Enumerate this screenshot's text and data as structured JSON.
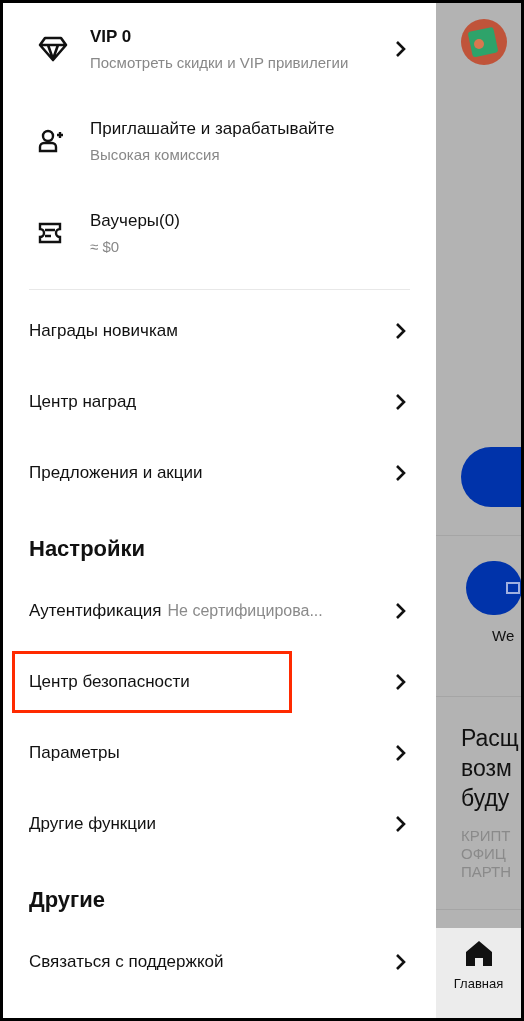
{
  "top_items": [
    {
      "kind": "diamond",
      "title": "VIP 0",
      "subtitle": "Посмотреть скидки и VIP привилегии",
      "chevron": true
    },
    {
      "kind": "person-add",
      "title": "Приглашайте и зарабатывайте",
      "subtitle": "Высокая комиссия",
      "chevron": false
    },
    {
      "kind": "ticket",
      "title": "Ваучеры(0)",
      "subtitle": "≈ $0",
      "chevron": false
    }
  ],
  "reward_items": [
    {
      "label": "Награды новичкам"
    },
    {
      "label": "Центр наград"
    },
    {
      "label": "Предложения и акции"
    }
  ],
  "sections": [
    {
      "title": "Настройки",
      "items": [
        {
          "label": "Аутентификация",
          "value": "Не сертифицирова...",
          "highlighted": false
        },
        {
          "label": "Центр безопасности",
          "highlighted": true
        },
        {
          "label": "Параметры",
          "highlighted": false
        },
        {
          "label": "Другие функции",
          "highlighted": false
        }
      ]
    },
    {
      "title": "Другие",
      "items": [
        {
          "label": "Связаться с поддержкой",
          "highlighted": false
        }
      ]
    }
  ],
  "background": {
    "banner_text": "We",
    "headline_lines": [
      "Расщ",
      "возм",
      "буду"
    ],
    "caption_lines": [
      "КРИПТ",
      "ОФИЦ",
      "ПАРТН"
    ],
    "nav_label": "Главная"
  }
}
